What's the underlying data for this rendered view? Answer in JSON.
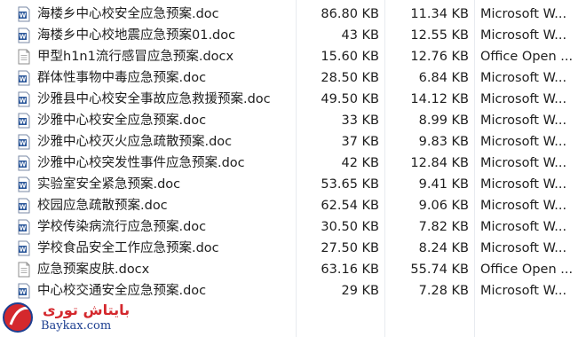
{
  "files": [
    {
      "name": "海楼乡中心校安全应急预案.doc",
      "size": "86.80 KB",
      "compressed": "11.34 KB",
      "type": "Microsoft W...",
      "icon": "word-doc-icon"
    },
    {
      "name": "海楼乡中心校地震应急预案01.doc",
      "size": "43 KB",
      "compressed": "12.55 KB",
      "type": "Microsoft W...",
      "icon": "word-doc-icon"
    },
    {
      "name": "甲型h1n1流行感冒应急预案.docx",
      "size": "15.60 KB",
      "compressed": "12.76 KB",
      "type": "Office Open ...",
      "icon": "generic-file-icon"
    },
    {
      "name": "群体性事物中毒应急预案.doc",
      "size": "28.50 KB",
      "compressed": "6.84 KB",
      "type": "Microsoft W...",
      "icon": "word-doc-icon"
    },
    {
      "name": "沙雅县中心校安全事故应急救援预案.doc",
      "size": "49.50 KB",
      "compressed": "14.12 KB",
      "type": "Microsoft W...",
      "icon": "word-doc-icon"
    },
    {
      "name": "沙雅中心校安全应急预案.doc",
      "size": "33 KB",
      "compressed": "8.99 KB",
      "type": "Microsoft W...",
      "icon": "word-doc-icon"
    },
    {
      "name": "沙雅中心校灭火应急疏散预案.doc",
      "size": "37 KB",
      "compressed": "9.83 KB",
      "type": "Microsoft W...",
      "icon": "word-doc-icon"
    },
    {
      "name": "沙雅中心校突发性事件应急预案.doc",
      "size": "42 KB",
      "compressed": "12.84 KB",
      "type": "Microsoft W...",
      "icon": "word-doc-icon"
    },
    {
      "name": "实验室安全紧急预案.doc",
      "size": "53.65 KB",
      "compressed": "9.41 KB",
      "type": "Microsoft W...",
      "icon": "word-doc-icon"
    },
    {
      "name": "校园应急疏散预案.doc",
      "size": "62.54 KB",
      "compressed": "9.06 KB",
      "type": "Microsoft W...",
      "icon": "word-doc-icon"
    },
    {
      "name": "学校传染病流行应急预案.doc",
      "size": "30.50 KB",
      "compressed": "7.82 KB",
      "type": "Microsoft W...",
      "icon": "word-doc-icon"
    },
    {
      "name": "学校食品安全工作应急预案.doc",
      "size": "27.50 KB",
      "compressed": "8.24 KB",
      "type": "Microsoft W...",
      "icon": "word-doc-icon"
    },
    {
      "name": "应急预案皮肤.docx",
      "size": "63.16 KB",
      "compressed": "55.74 KB",
      "type": "Office Open ...",
      "icon": "generic-file-icon"
    },
    {
      "name": "中心校交通安全应急预案.doc",
      "size": "29 KB",
      "compressed": "7.28 KB",
      "type": "Microsoft W...",
      "icon": "word-doc-icon"
    }
  ],
  "watermark": {
    "text": "بايتاش تورى",
    "url": "Baykax.com",
    "icon": "watermark-logo-icon"
  },
  "colors": {
    "word_icon_blue": "#2b579a",
    "column_separator": "#e8ebf0",
    "watermark_red": "#d4282d",
    "watermark_blue": "#1d3f91"
  }
}
